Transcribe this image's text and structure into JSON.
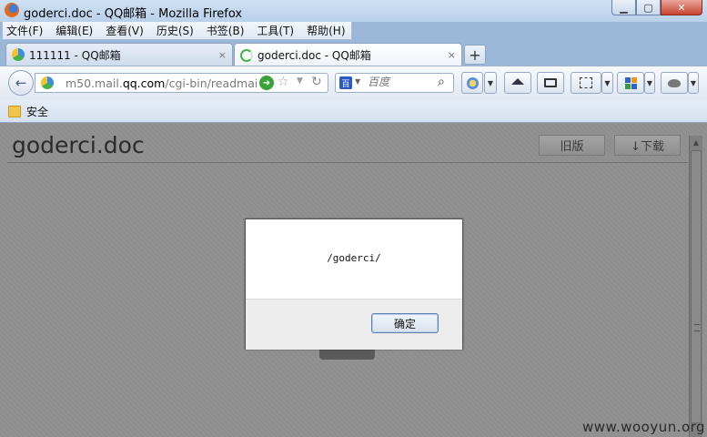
{
  "window": {
    "title": "goderci.doc - QQ邮箱 - Mozilla Firefox",
    "minimize_label": "▁",
    "maximize_label": "▢",
    "close_label": "✕"
  },
  "menu": {
    "items": [
      {
        "label": "文件(F)"
      },
      {
        "label": "编辑(E)"
      },
      {
        "label": "查看(V)"
      },
      {
        "label": "历史(S)"
      },
      {
        "label": "书签(B)"
      },
      {
        "label": "工具(T)"
      },
      {
        "label": "帮助(H)"
      }
    ]
  },
  "tabs": [
    {
      "label": "111111 - QQ邮箱",
      "close": "×",
      "active": false
    },
    {
      "label": "goderci.doc - QQ邮箱",
      "close": "×",
      "active": true
    }
  ],
  "new_tab_label": "+",
  "nav": {
    "back_glyph": "←",
    "url_prefix": "m50.mail.",
    "url_domain": "qq.com",
    "url_path": "/cgi-bin/readmail?",
    "go_glyph": "➜",
    "star_glyph": "☆",
    "drop_glyph": "▼",
    "reload_glyph": "↻",
    "search_placeholder": "百度",
    "search_engine_glyph": "百",
    "search_go_glyph": "⌕",
    "toolbar_icons": [
      "status-icon",
      "home-icon",
      "mail-icon",
      "screenshot-icon",
      "apps-icon",
      "extension-icon"
    ]
  },
  "bookmarks": {
    "items": [
      {
        "label": "安全"
      }
    ]
  },
  "viewer": {
    "doc_title": "goderci.doc",
    "old_version_label": "旧版",
    "download_label": "↓下载"
  },
  "alert": {
    "message": "/goderci/",
    "ok_label": "确定"
  },
  "watermark": "www.wooyun.org",
  "colors": {
    "content_bg": "#8e8e8e",
    "chrome_blue": "#b9d0ea",
    "close_red": "#c74431"
  }
}
